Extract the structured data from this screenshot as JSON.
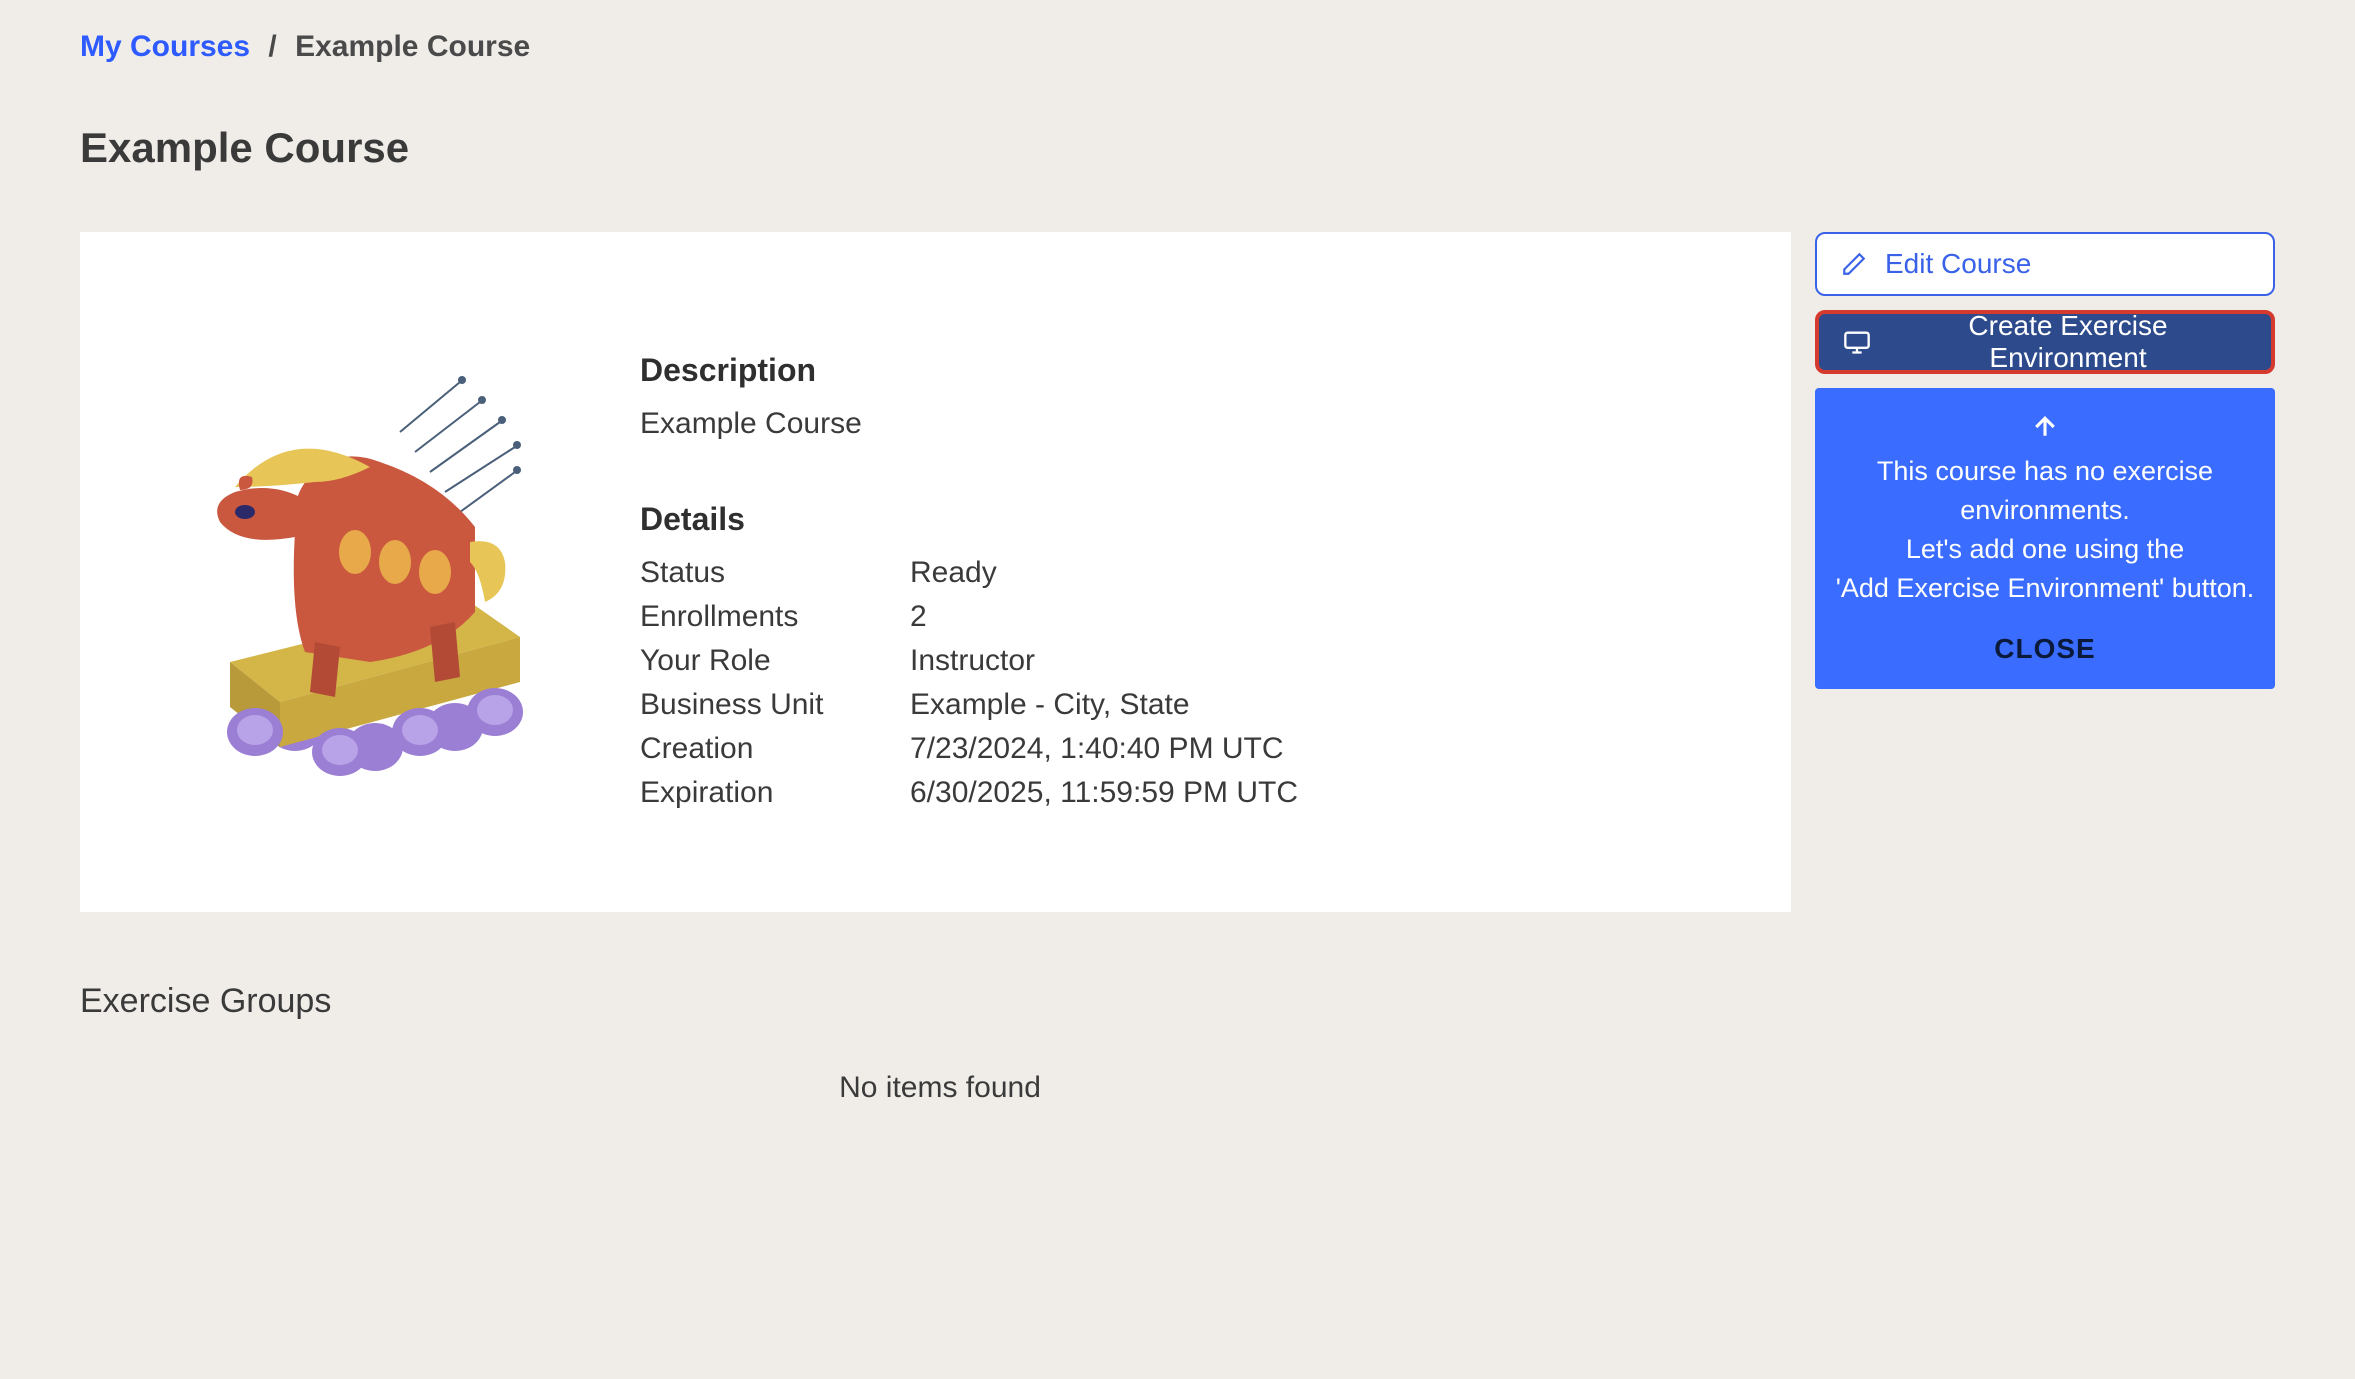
{
  "breadcrumb": {
    "root": "My Courses",
    "separator": "/",
    "current": "Example Course"
  },
  "page_title": "Example Course",
  "description": {
    "heading": "Description",
    "text": "Example Course"
  },
  "details": {
    "heading": "Details",
    "rows": {
      "status_label": "Status",
      "status_value": "Ready",
      "enrollments_label": "Enrollments",
      "enrollments_value": "2",
      "role_label": "Your Role",
      "role_value": "Instructor",
      "bu_label": "Business Unit",
      "bu_value": "Example - City, State",
      "creation_label": "Creation",
      "creation_value": "7/23/2024, 1:40:40 PM UTC",
      "expiration_label": "Expiration",
      "expiration_value": "6/30/2025, 11:59:59 PM UTC"
    }
  },
  "actions": {
    "edit": "Edit Course",
    "create_env": "Create Exercise Environment"
  },
  "tip": {
    "line1": "This course has no exercise environments.",
    "line2": "Let's add one using the",
    "line3": "'Add Exercise Environment' button.",
    "close": "CLOSE"
  },
  "groups": {
    "heading": "Exercise Groups",
    "empty": "No items found"
  }
}
